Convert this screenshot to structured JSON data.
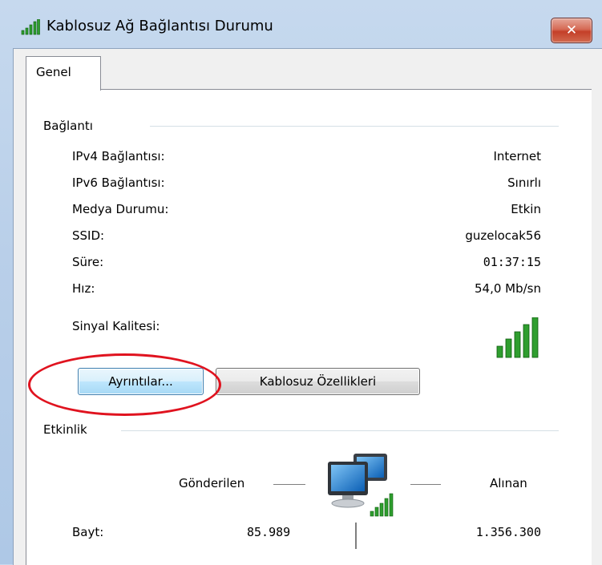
{
  "window": {
    "title": "Kablosuz Ağ Bağlantısı Durumu",
    "close_label": "✕"
  },
  "tabs": [
    {
      "label": "Genel",
      "selected": true
    }
  ],
  "connection": {
    "group_label": "Bağlantı",
    "rows": [
      {
        "label": "IPv4 Bağlantısı:",
        "value": "Internet"
      },
      {
        "label": "IPv6 Bağlantısı:",
        "value": "Sınırlı"
      },
      {
        "label": "Medya Durumu:",
        "value": "Etkin"
      },
      {
        "label": "SSID:",
        "value": "guzelocak56"
      },
      {
        "label": "Süre:",
        "value": "01:37:15"
      },
      {
        "label": "Hız:",
        "value": "54,0 Mb/sn"
      }
    ],
    "signal_label": "Sinyal Kalitesi:",
    "signal_bars": 5,
    "signal_bars_max": 5
  },
  "buttons": {
    "details": "Ayrıntılar...",
    "wireless_properties": "Kablosuz Özellikleri"
  },
  "activity": {
    "group_label": "Etkinlik",
    "sent_label": "Gönderilen",
    "received_label": "Alınan",
    "bytes_label": "Bayt:",
    "sent_bytes": "85.989",
    "received_bytes": "1.356.300"
  },
  "colors": {
    "signal_green": "#2f9e2f",
    "highlight_circle": "#e0131f",
    "close_button": "#c9452e"
  }
}
